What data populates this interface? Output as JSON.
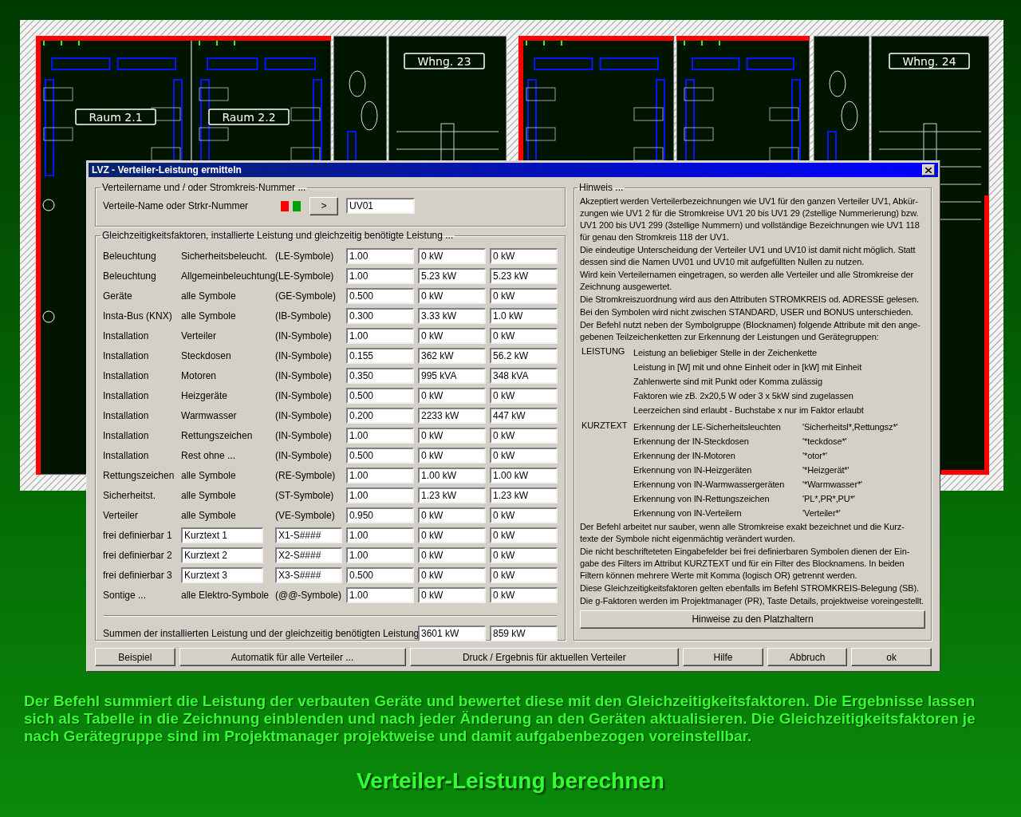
{
  "drawing": {
    "room_labels": [
      "Raum 2.1",
      "Raum 2.2",
      "Whng. 23",
      "Whng. 24"
    ]
  },
  "window": {
    "title": "LVZ - Verteiler-Leistung ermitteln"
  },
  "distributor_group": {
    "legend": "Verteilername und / oder Stromkreis-Nummer ...",
    "label": "Verteile-Name oder Strkr-Nummer",
    "status_indicators": [
      {
        "color": "#ff0000"
      },
      {
        "color": "#00a000"
      }
    ],
    "pick_button": ">",
    "value": "UV01"
  },
  "factors_group": {
    "legend": "Gleichzeitigkeitsfaktoren, installierte Leistung und gleichzeitig benötigte Leistung ...",
    "rows": [
      {
        "kind": "fixed",
        "group": "Beleuchtung",
        "type": "Sicherheitsbeleucht.",
        "symbols": "(LE-Symbole)",
        "factor": "1.00",
        "installed": "0 kW",
        "required": "0 kW"
      },
      {
        "kind": "fixed",
        "group": "Beleuchtung",
        "type": "Allgemeinbeleuchtung",
        "symbols": "(LE-Symbole)",
        "factor": "1.00",
        "installed": "5.23 kW",
        "required": "5.23 kW"
      },
      {
        "kind": "fixed",
        "group": "Geräte",
        "type": "alle Symbole",
        "symbols": "(GE-Symbole)",
        "factor": "0.500",
        "installed": "0 kW",
        "required": "0 kW"
      },
      {
        "kind": "fixed",
        "group": "Insta-Bus (KNX)",
        "type": "alle Symbole",
        "symbols": "(IB-Symbole)",
        "factor": "0.300",
        "installed": "3.33 kW",
        "required": "1.0 kW"
      },
      {
        "kind": "fixed",
        "group": "Installation",
        "type": "Verteiler",
        "symbols": "(IN-Symbole)",
        "factor": "1.00",
        "installed": "0 kW",
        "required": "0 kW"
      },
      {
        "kind": "fixed",
        "group": "Installation",
        "type": "Steckdosen",
        "symbols": "(IN-Symbole)",
        "factor": "0.155",
        "installed": "362 kW",
        "required": "56.2 kW"
      },
      {
        "kind": "fixed",
        "group": "Installation",
        "type": "Motoren",
        "symbols": "(IN-Symbole)",
        "factor": "0.350",
        "installed": "995 kVA",
        "required": "348 kVA"
      },
      {
        "kind": "fixed",
        "group": "Installation",
        "type": "Heizgeräte",
        "symbols": "(IN-Symbole)",
        "factor": "0.500",
        "installed": "0 kW",
        "required": "0 kW"
      },
      {
        "kind": "fixed",
        "group": "Installation",
        "type": "Warmwasser",
        "symbols": "(IN-Symbole)",
        "factor": "0.200",
        "installed": "2233 kW",
        "required": "447 kW"
      },
      {
        "kind": "fixed",
        "group": "Installation",
        "type": "Rettungszeichen",
        "symbols": "(IN-Symbole)",
        "factor": "1.00",
        "installed": "0 kW",
        "required": "0 kW"
      },
      {
        "kind": "fixed",
        "group": "Installation",
        "type": "Rest ohne ...",
        "symbols": "(IN-Symbole)",
        "factor": "0.500",
        "installed": "0 kW",
        "required": "0 kW"
      },
      {
        "kind": "fixed",
        "group": "Rettungszeichen",
        "type": "alle Symbole",
        "symbols": "(RE-Symbole)",
        "factor": "1.00",
        "installed": "1.00 kW",
        "required": "1.00 kW"
      },
      {
        "kind": "fixed",
        "group": "Sicherheitst.",
        "type": "alle Symbole",
        "symbols": "(ST-Symbole)",
        "factor": "1.00",
        "installed": "1.23 kW",
        "required": "1.23 kW"
      },
      {
        "kind": "fixed",
        "group": "Verteiler",
        "type": "alle Symbole",
        "symbols": "(VE-Symbole)",
        "factor": "0.950",
        "installed": "0 kW",
        "required": "0 kW"
      },
      {
        "kind": "editable",
        "group": "frei definierbar 1",
        "type": "Kurztext 1",
        "symbols": "X1-S####",
        "factor": "1.00",
        "installed": "0 kW",
        "required": "0 kW"
      },
      {
        "kind": "editable",
        "group": "frei definierbar 2",
        "type": "Kurztext 2",
        "symbols": "X2-S####",
        "factor": "1.00",
        "installed": "0 kW",
        "required": "0 kW"
      },
      {
        "kind": "editable",
        "group": "frei definierbar 3",
        "type": "Kurztext 3",
        "symbols": "X3-S####",
        "factor": "0.500",
        "installed": "0 kW",
        "required": "0 kW"
      },
      {
        "kind": "fixed",
        "group": "Sontige ...",
        "type": "alle Elektro-Symbole",
        "symbols": "(@@-Symbole)",
        "factor": "1.00",
        "installed": "0 kW",
        "required": "0 kW"
      }
    ],
    "sum_label": "Summen der installierten Leistung und der gleichzeitig benötigten Leistung",
    "sum_installed": "3601 kW",
    "sum_required": "859 kW"
  },
  "hint_group": {
    "legend": "Hinweis ...",
    "paragraphs_before": [
      {
        "lines": [
          "Akzeptiert werden Verteilerbezeichnungen wie UV1 für den ganzen Verteiler UV1, Abkür-",
          "zungen wie UV1 2 für die Stromkreise UV1 20 bis UV1 29 (2stellige Nummerierung) bzw.",
          "UV1 200 bis UV1 299 (3stellige Nummern) und vollständige Bezeichnungen wie UV1 118",
          "für genau den Stromkreis 118 der UV1."
        ]
      },
      {
        "lines": [
          "Die eindeutige Unterscheidung der Verteiler UV1 und UV10 ist damit nicht möglich. Statt",
          "dessen sind die Namen UV01 und UV10 mit aufgefüllten Nullen zu nutzen."
        ]
      },
      {
        "lines": [
          "Wird kein Verteilernamen eingetragen, so werden alle Verteiler und alle Stromkreise der",
          "Zeichnung ausgewertet."
        ]
      },
      {
        "lines": [
          "Die Stromkreiszuordnung wird aus den Attributen STROMKREIS od. ADRESSE gelesen."
        ]
      },
      {
        "lines": [
          "Bei den Symbolen wird nicht zwischen STANDARD, USER und BONUS unterschieden."
        ]
      },
      {
        "lines": [
          "Der Befehl nutzt neben der Symbolgruppe (Blocknamen) folgende Attribute mit den ange-",
          "gebenen Teilzeichenketten zur Erkennung der Leistungen und Gerätegruppen:"
        ]
      }
    ],
    "attributes": [
      {
        "name": "LEISTUNG",
        "entries": [
          {
            "text": "Leistung an beliebiger Stelle in der Zeichenkette"
          },
          {
            "text": "Leistung in [W] mit und ohne Einheit oder in [kW] mit Einheit"
          },
          {
            "text": "Zahlenwerte sind mit Punkt oder Komma zulässig"
          },
          {
            "text": "Faktoren wie zB. 2x20,5 W oder 3 x 5kW sind zugelassen"
          },
          {
            "text": "Leerzeichen sind erlaubt - Buchstabe x nur im Faktor erlaubt"
          }
        ]
      },
      {
        "name": "KURZTEXT",
        "entries": [
          {
            "text": "Erkennung der LE-Sicherheitsleuchten",
            "pattern": "'Sicherheitsl*,Rettungsz*'"
          },
          {
            "text": "Erkennung der IN-Steckdosen",
            "pattern": "'*teckdose*'"
          },
          {
            "text": "Erkennung der IN-Motoren",
            "pattern": "'*otor*'"
          },
          {
            "text": "Erkennung von IN-Heizgeräten",
            "pattern": "'*Heizgerät*'"
          },
          {
            "text": "Erkennung von IN-Warmwassergeräten",
            "pattern": "'*Warmwasser*'"
          },
          {
            "text": "Erkennung von IN-Rettungszeichen",
            "pattern": "'PL*,PR*,PU*'"
          },
          {
            "text": "Erkennung von IN-Verteilern",
            "pattern": "'Verteiler*'"
          }
        ]
      }
    ],
    "paragraphs_after": [
      {
        "lines": [
          "Der Befehl arbeitet nur sauber, wenn alle Stromkreise exakt bezeichnet und die Kurz-",
          "texte der Symbole nicht eigenmächtig verändert wurden."
        ]
      },
      {
        "lines": [
          "Die nicht beschrifteteten Eingabefelder bei frei definierbaren Symbolen dienen der Ein-",
          "gabe des Filters im Attribut KURZTEXT und für ein Filter des Blocknamens. In beiden",
          "Filtern können mehrere Werte mit Komma (logisch OR) getrennt werden."
        ]
      },
      {
        "lines": [
          "Diese Gleichzeitigkeitsfaktoren gelten ebenfalls im Befehl STROMKREIS-Belegung (SB)."
        ]
      },
      {
        "lines": [
          "Die g-Faktoren werden im Projektmanager (PR), Taste Details, projektweise voreingestellt."
        ]
      }
    ],
    "button": "Hinweise zu den Platzhaltern"
  },
  "buttons": [
    {
      "label": "Beispiel"
    },
    {
      "label": "Automatik für alle Verteiler ..."
    },
    {
      "label": "Druck / Ergebnis für aktuellen Verteiler"
    },
    {
      "label": "Hilfe"
    },
    {
      "label": "Abbruch"
    },
    {
      "label": "ok"
    }
  ],
  "caption": "Der Befehl summiert die Leistung der verbauten Geräte und bewertet diese mit den Gleichzeitigkeitsfaktoren. Die Ergebnisse lassen sich als Tabelle in die Zeichnung einblenden und nach jeder Änderung an den Geräten aktualisieren. Die Gleichzeitigkeitsfaktoren je nach Gerätegruppe sind im Projektmanager projektweise und damit aufgabenbezogen voreinstellbar.",
  "headline": "Verteiler-Leistung berechnen"
}
